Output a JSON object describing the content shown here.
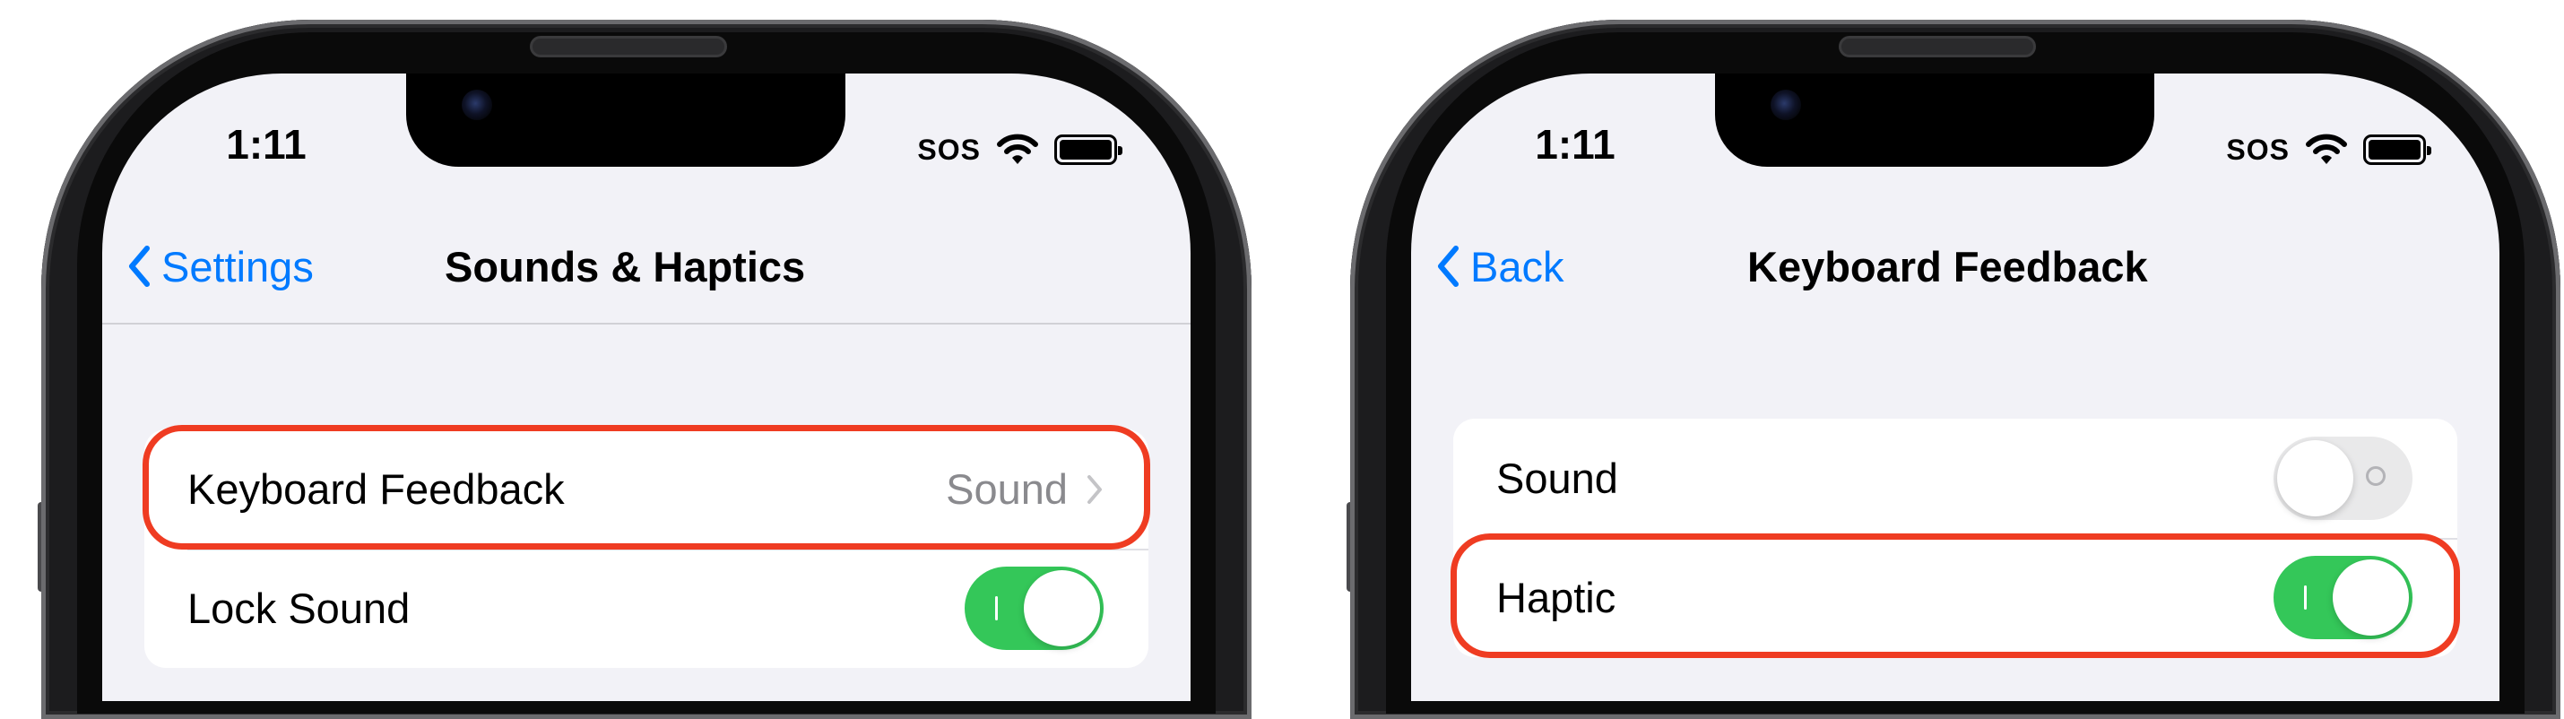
{
  "status_bar": {
    "time": "1:11",
    "carrier": "SOS"
  },
  "left_screen": {
    "nav": {
      "back_label": "Settings",
      "title": "Sounds & Haptics"
    },
    "rows": [
      {
        "label": "Keyboard Feedback",
        "value": "Sound"
      },
      {
        "label": "Lock Sound",
        "toggle": true
      }
    ]
  },
  "right_screen": {
    "nav": {
      "back_label": "Back",
      "title": "Keyboard Feedback"
    },
    "rows": [
      {
        "label": "Sound",
        "toggle": false
      },
      {
        "label": "Haptic",
        "toggle": true
      }
    ]
  },
  "colors": {
    "accent": "#007aff",
    "toggle_on": "#34c759",
    "highlight": "#ef3c22",
    "grouped_background": "#f2f2f7"
  }
}
